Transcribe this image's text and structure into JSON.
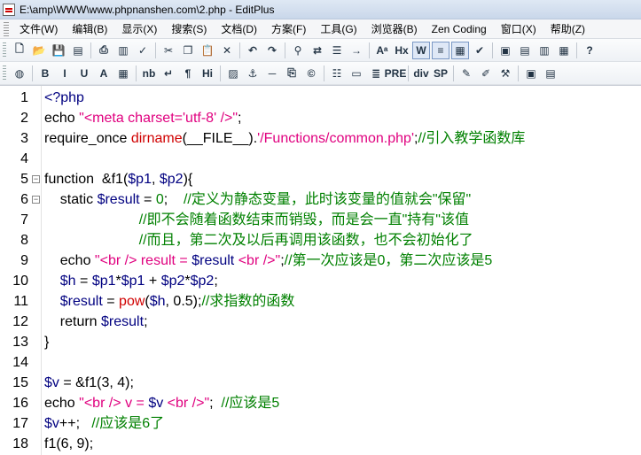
{
  "window": {
    "title": "E:\\amp\\WWW\\www.phpnanshen.com\\2.php - EditPlus"
  },
  "menu": [
    "文件(W)",
    "编辑(B)",
    "显示(X)",
    "搜索(S)",
    "文档(D)",
    "方案(F)",
    "工具(G)",
    "浏览器(B)",
    "Zen Coding",
    "窗口(X)",
    "帮助(Z)"
  ],
  "toolbar1": [
    "new-icon",
    "open-icon",
    "save-icon",
    "save-all-icon",
    "sep",
    "print-icon",
    "print-preview-icon",
    "spellcheck-icon",
    "sep",
    "cut-icon",
    "copy-icon",
    "paste-icon",
    "delete-icon",
    "sep",
    "undo-icon",
    "redo-icon",
    "sep",
    "find-icon",
    "replace-icon",
    "find-in-files-icon",
    "goto-line-icon",
    "sep",
    "font-icon",
    "hex-icon",
    "word-wrap-icon",
    "line-numbers-icon",
    "column-marker-icon",
    "check-icon",
    "sep",
    "view1-icon",
    "view2-icon",
    "view3-icon",
    "view4-icon",
    "sep",
    "help-icon"
  ],
  "toolbar2": [
    "browser-icon",
    "sep",
    "B",
    "I",
    "U",
    "A",
    "table-icon",
    "sep",
    "nb",
    "↵",
    "¶",
    "Hi",
    "sep",
    "image-icon",
    "anchor-icon",
    "hr-icon",
    "link-icon",
    "copyright-icon",
    "sep",
    "list-icon",
    "form-icon",
    "center-icon",
    "PRE",
    "sep",
    "div",
    "SP",
    "sep",
    "edit-icon",
    "marker-icon",
    "tools-icon",
    "sep",
    "frame-icon",
    "panel-icon"
  ],
  "code_lines": [
    [
      [
        "t",
        "<?php"
      ]
    ],
    [
      [
        "d",
        "echo "
      ],
      [
        "s",
        "\"<meta charset='utf-8' />\""
      ],
      [
        "d",
        ";"
      ]
    ],
    [
      [
        "d",
        "require_once "
      ],
      [
        "f",
        "dirname"
      ],
      [
        "d",
        "(__FILE__)."
      ],
      [
        "s",
        "'/Functions/common.php'"
      ],
      [
        "d",
        ";"
      ],
      [
        "c",
        "//引入教学函数库"
      ]
    ],
    [],
    [
      [
        "d",
        "function  &f1("
      ],
      [
        "t",
        "$p1"
      ],
      [
        "d",
        ", "
      ],
      [
        "t",
        "$p2"
      ],
      [
        "d",
        "){"
      ]
    ],
    [
      [
        "d",
        "    static "
      ],
      [
        "t",
        "$result"
      ],
      [
        "d",
        " = "
      ],
      [
        "c",
        "0"
      ],
      [
        "d",
        ";    "
      ],
      [
        "c",
        "//定义为静态变量，此时该变量的值就会\"保留\""
      ]
    ],
    [
      [
        "c",
        "                        //即不会随着函数结束而销毁，而是会一直\"持有\"该值"
      ]
    ],
    [
      [
        "c",
        "                        //而且，第二次及以后再调用该函数，也不会初始化了"
      ]
    ],
    [
      [
        "d",
        "    echo "
      ],
      [
        "s",
        "\"<br /> result = "
      ],
      [
        "t",
        "$result"
      ],
      [
        "s",
        " <br />\""
      ],
      [
        "d",
        ";"
      ],
      [
        "c",
        "//第一次应该是0，第二次应该是5"
      ]
    ],
    [
      [
        "d",
        "    "
      ],
      [
        "t",
        "$h"
      ],
      [
        "d",
        " = "
      ],
      [
        "t",
        "$p1"
      ],
      [
        "d",
        "*"
      ],
      [
        "t",
        "$p1"
      ],
      [
        "d",
        " + "
      ],
      [
        "t",
        "$p2"
      ],
      [
        "d",
        "*"
      ],
      [
        "t",
        "$p2"
      ],
      [
        "d",
        ";"
      ]
    ],
    [
      [
        "d",
        "    "
      ],
      [
        "t",
        "$result"
      ],
      [
        "d",
        " = "
      ],
      [
        "f",
        "pow"
      ],
      [
        "d",
        "("
      ],
      [
        "t",
        "$h"
      ],
      [
        "d",
        ", 0.5);"
      ],
      [
        "c",
        "//求指数的函数"
      ]
    ],
    [
      [
        "d",
        "    return "
      ],
      [
        "t",
        "$result"
      ],
      [
        "d",
        ";"
      ]
    ],
    [
      [
        "d",
        "}"
      ]
    ],
    [],
    [
      [
        "t",
        "$v"
      ],
      [
        "d",
        " = &f1(3, 4);"
      ]
    ],
    [
      [
        "d",
        "echo "
      ],
      [
        "s",
        "\"<br /> v = "
      ],
      [
        "t",
        "$v"
      ],
      [
        "s",
        " <br />\""
      ],
      [
        "d",
        ";  "
      ],
      [
        "c",
        "//应该是5"
      ]
    ],
    [
      [
        "t",
        "$v"
      ],
      [
        "d",
        "++;   "
      ],
      [
        "c",
        "//应该是6了"
      ]
    ],
    [
      [
        "d",
        "f1(6, 9);"
      ]
    ]
  ],
  "line_numbers": [
    "1",
    "2",
    "3",
    "4",
    "5",
    "6",
    "7",
    "8",
    "9",
    "10",
    "11",
    "12",
    "13",
    "14",
    "15",
    "16",
    "17",
    "18"
  ],
  "folds": {
    "5": "−",
    "6": "−"
  }
}
